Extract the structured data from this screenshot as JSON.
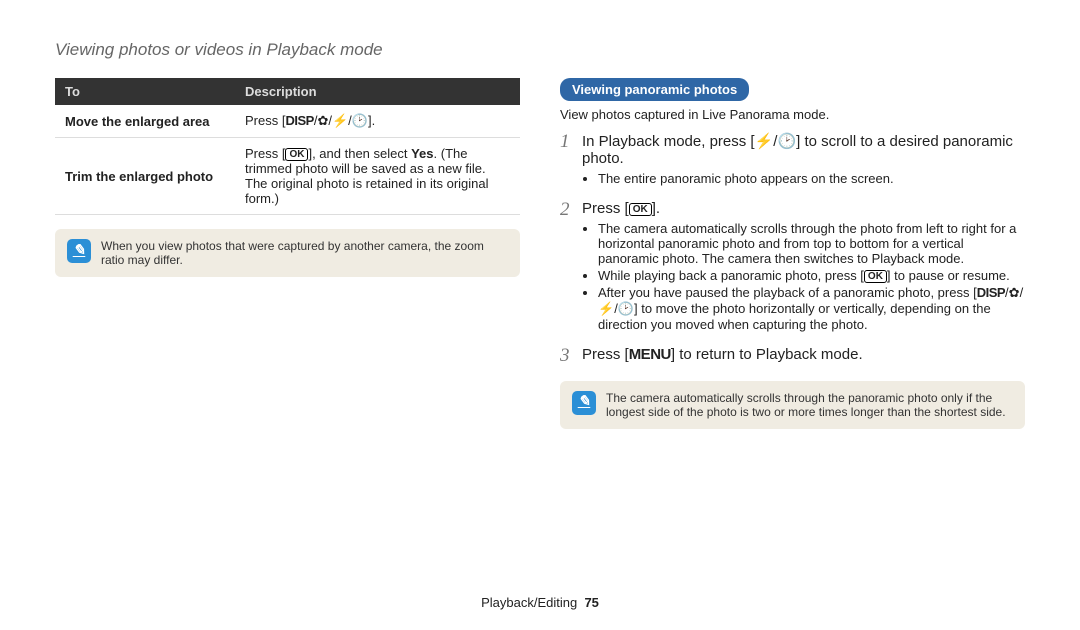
{
  "page_title": "Viewing photos or videos in Playback mode",
  "table": {
    "header_left": "To",
    "header_right": "Description",
    "rows": [
      {
        "head": "Move the enlarged area",
        "desc_pre": "Press [",
        "desc_disp": "DISP",
        "desc_post": "/",
        "desc_tail": "]."
      },
      {
        "head": "Trim the enlarged photo",
        "desc_pre": "Press [",
        "desc_mid": "], and then select ",
        "desc_yes": "Yes",
        "desc_post": ". (The trimmed photo will be saved as a new file. The original photo is retained in its original form.)"
      }
    ]
  },
  "left_note": "When you view photos that were captured by another camera, the zoom ratio may differ.",
  "right": {
    "section_label": "Viewing panoramic photos",
    "intro": "View photos captured in Live Panorama mode.",
    "step1_pre": "In Playback mode, press [",
    "step1_post": "] to scroll to a desired panoramic photo.",
    "step1_bullet": "The entire panoramic photo appears on the screen.",
    "step2_pre": "Press [",
    "step2_post": "].",
    "step2_b1": "The camera automatically scrolls through the photo from left to right for a horizontal panoramic photo and from top to bottom for a vertical panoramic photo. The camera then switches to Playback mode.",
    "step2_b2_pre": "While playing back a panoramic photo, press [",
    "step2_b2_post": "] to pause or resume.",
    "step2_b3_pre": "After you have paused the playback of a panoramic photo, press [",
    "step2_b3_disp": "DISP",
    "step2_b3_post": "] to move the photo horizontally or vertically, depending on the direction you moved when capturing the photo.",
    "step3_pre": "Press [",
    "step3_menu": "MENU",
    "step3_post": "] to return to Playback mode.",
    "right_note": "The camera automatically scrolls through the panoramic photo only if the longest side of the photo is two or more times longer than the shortest side."
  },
  "footer_label": "Playback/Editing",
  "footer_page": "75"
}
